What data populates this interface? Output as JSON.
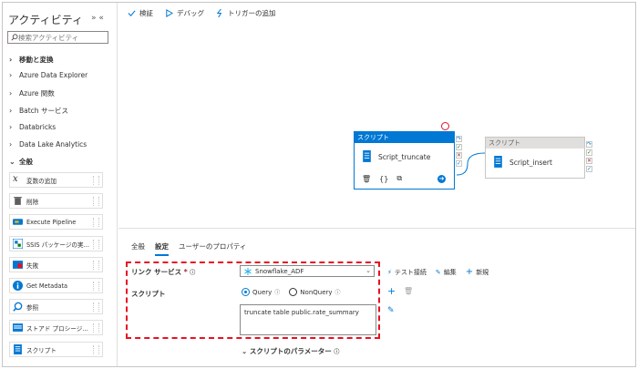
{
  "sidebar": {
    "title": "アクティビティ",
    "collapse_glyph": "» «",
    "search_placeholder": "検索アクティビティ",
    "categories": [
      {
        "label": "移動と変換",
        "bold": true
      },
      {
        "label": "Azure Data Explorer"
      },
      {
        "label": "Azure 関数"
      },
      {
        "label": "Batch サービス"
      },
      {
        "label": "Databricks"
      },
      {
        "label": "Data Lake Analytics"
      }
    ],
    "general_label": "全般",
    "activities": [
      {
        "label": "変数の追加",
        "icon": "variable-icon"
      },
      {
        "label": "削除",
        "icon": "trash-icon"
      },
      {
        "label": "Execute Pipeline",
        "icon": "pipeline-icon"
      },
      {
        "label": "SSIS パッケージの実...",
        "icon": "ssis-icon"
      },
      {
        "label": "失敗",
        "icon": "fail-icon"
      },
      {
        "label": "Get Metadata",
        "icon": "info-icon"
      },
      {
        "label": "参照",
        "icon": "lookup-icon"
      },
      {
        "label": "ストアド プロシージ...",
        "icon": "stored-proc-icon"
      },
      {
        "label": "スクリプト",
        "icon": "script-icon"
      }
    ]
  },
  "toolbar": {
    "validate": "検証",
    "debug": "デバッグ",
    "add_trigger": "トリガーの追加"
  },
  "canvas": {
    "node1": {
      "header": "スクリプト",
      "name": "Script_truncate"
    },
    "node2": {
      "header": "スクリプト",
      "name": "Script_insert"
    }
  },
  "props": {
    "tabs": [
      "全般",
      "設定",
      "ユーザーのプロパティ"
    ],
    "active_tab": 1,
    "linked_service_label": "リンク サービス",
    "linked_service_value": "Snowflake_ADF",
    "test_connection": "テスト接続",
    "edit": "編集",
    "new": "新規",
    "script_label": "スクリプト",
    "radio_query": "Query",
    "radio_nonquery": "NonQuery",
    "script_text": "truncate table public.rate_summary",
    "params_label": "スクリプトのパラメーター"
  },
  "colors": {
    "accent": "#0078d4",
    "highlight": "#e81123"
  }
}
